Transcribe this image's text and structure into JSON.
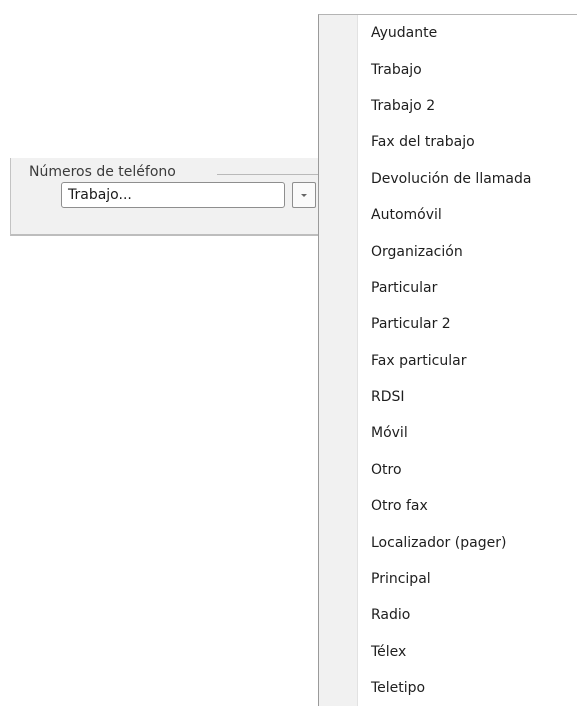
{
  "phone_group": {
    "title": "Números de teléfono",
    "selected_value": "Trabajo...",
    "dropdown_button_icon": "chevron-down-icon"
  },
  "dropdown": {
    "items": [
      {
        "label": "Ayudante"
      },
      {
        "label": "Trabajo"
      },
      {
        "label": "Trabajo 2"
      },
      {
        "label": "Fax del trabajo"
      },
      {
        "label": "Devolución de llamada"
      },
      {
        "label": "Automóvil"
      },
      {
        "label": "Organización"
      },
      {
        "label": "Particular"
      },
      {
        "label": "Particular 2"
      },
      {
        "label": "Fax particular"
      },
      {
        "label": "RDSI"
      },
      {
        "label": "Móvil"
      },
      {
        "label": "Otro"
      },
      {
        "label": "Otro fax"
      },
      {
        "label": "Localizador (pager)"
      },
      {
        "label": "Principal"
      },
      {
        "label": "Radio"
      },
      {
        "label": "Télex"
      },
      {
        "label": "Teletipo"
      }
    ]
  }
}
